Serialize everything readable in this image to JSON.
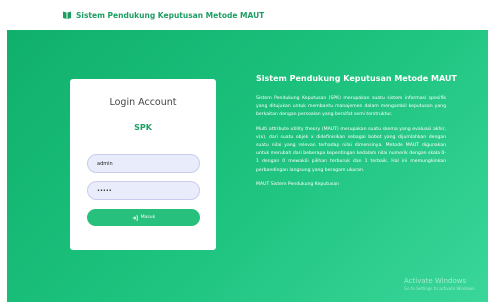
{
  "header": {
    "title": "Sistem Pendukung Keputusan Metode MAUT",
    "icon": "book-icon",
    "brand_color": "#1c9e63"
  },
  "login": {
    "title": "Login Account",
    "subtitle": "SPK",
    "username_value": "admin",
    "password_value": "•••••",
    "button_label": "Masuk",
    "button_icon": "sign-in-icon"
  },
  "info": {
    "title": "Sistem Pendukung Keputusan Metode MAUT",
    "paragraphs": [
      "Sistem Pendukung Keputusan (SPK) merupakan suatu sistem informasi spesifik yang ditujukan untuk membantu manajemen dalam mengambil keputusan yang berkaitan dengan persoalan yang bersifat semi terstruktur.",
      "Multi attribute utility theory (MAUT) merupakan suatu skema yang evaluasi akhir, v(x), dari suatu objek x didefinisikan sebagai bobot yang dijumlahkan dengan suatu nilai yang relevan terhadap nilai dimensinya. Metode MAUT digunakan untuk merubah dari beberapa kepentingan kedalam nilai numerik dengan skala 0-1 dengan 0 mewakili pilihan terburuk dan 1 terbaik. Hal ini memungkinkan perbandingan langsung yang beragam ukuran.",
      "MAUT Sistem Pendukung Keputusan"
    ]
  },
  "watermark": {
    "line1": "Activate Windows",
    "line2": "Go to Settings to activate Windows."
  },
  "colors": {
    "accent": "#1cc27d",
    "button": "#27c07c"
  }
}
